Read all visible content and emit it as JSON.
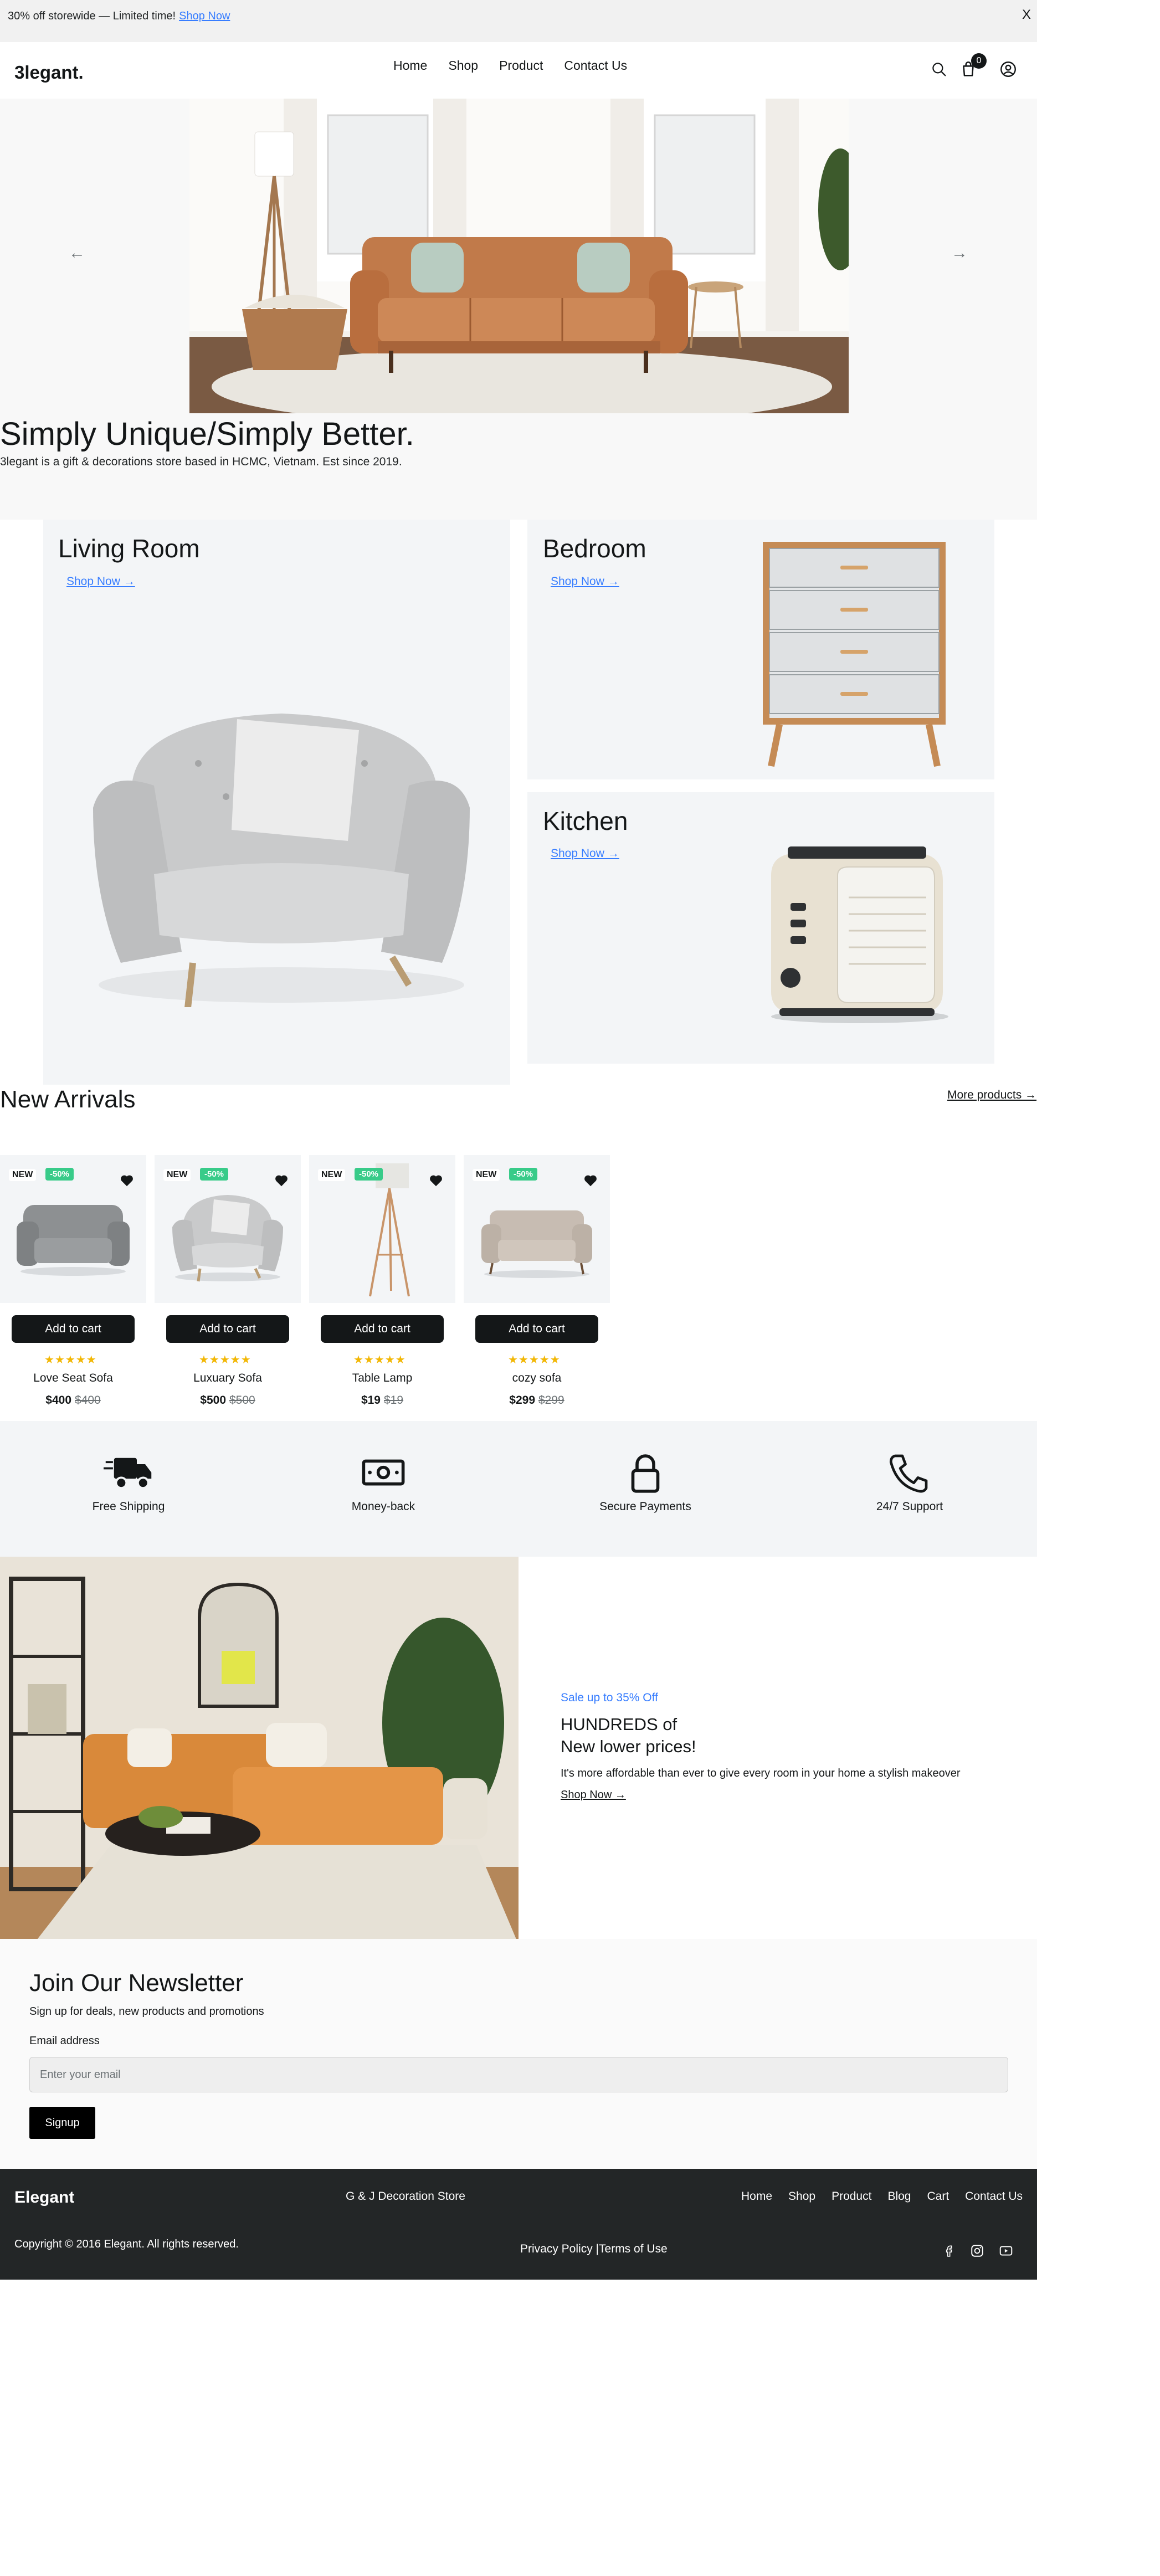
{
  "promo": {
    "text": "30% off storewide — Limited time!",
    "link": "Shop Now",
    "close": "X"
  },
  "header": {
    "logo": "3legant.",
    "nav": [
      "Home",
      "Shop",
      "Product",
      "Contact Us"
    ],
    "cart_count": "0",
    "icons": [
      "search-icon",
      "shopping-bag-icon",
      "user-account-icon"
    ]
  },
  "hero": {
    "prev_arrow": "←",
    "next_arrow": "→",
    "title": "Simply Unique/Simply Better.",
    "subtitle": "3legant is a gift & decorations store based in HCMC, Vietnam. Est since 2019."
  },
  "categories": [
    {
      "title": "Living Room",
      "link": "Shop Now →"
    },
    {
      "title": "Bedroom",
      "link": "Shop Now →"
    },
    {
      "title": "Kitchen",
      "link": "Shop Now →"
    }
  ],
  "new_arrivals": {
    "title": "New Arrivals",
    "more": "More products →",
    "products": [
      {
        "badge_new": "NEW",
        "badge_off": "-50%",
        "button": "Add to cart",
        "stars": "★★★★★",
        "name": "Love Seat Sofa",
        "price": "$400",
        "old_price": "$400"
      },
      {
        "badge_new": "NEW",
        "badge_off": "-50%",
        "button": "Add to cart",
        "stars": "★★★★★",
        "name": "Luxuary Sofa",
        "price": "$500",
        "old_price": "$500"
      },
      {
        "badge_new": "NEW",
        "badge_off": "-50%",
        "button": "Add to cart",
        "stars": "★★★★★",
        "name": "Table Lamp",
        "price": "$19",
        "old_price": "$19"
      },
      {
        "badge_new": "NEW",
        "badge_off": "-50%",
        "button": "Add to cart",
        "stars": "★★★★★",
        "name": "cozy sofa",
        "price": "$299",
        "old_price": "$299"
      }
    ]
  },
  "features": [
    {
      "label": "Free Shipping",
      "icon": "delivery-truck-icon"
    },
    {
      "label": "Money-back",
      "icon": "money-icon"
    },
    {
      "label": "Secure Payments",
      "icon": "lock-icon"
    },
    {
      "label": "24/7 Support",
      "icon": "phone-icon"
    }
  ],
  "banner": {
    "sale": "Sale up to 35% Off",
    "heading_line1": "HUNDREDS of",
    "heading_line2": "New lower prices!",
    "text": "It's more affordable than ever to give every room in your home a stylish makeover",
    "link": "Shop Now →"
  },
  "newsletter": {
    "title": "Join Our Newsletter",
    "subtitle": "Sign up for deals, new products and promotions",
    "label": "Email address",
    "placeholder": "Enter your email",
    "button": "Signup"
  },
  "footer": {
    "logo": "Elegant",
    "store": "G & J Decoration Store",
    "nav": [
      "Home",
      "Shop",
      "Product",
      "Blog",
      "Cart",
      "Contact Us"
    ],
    "copyright": "Copyright © 2016 Elegant. All rights reserved.",
    "privacy": "Privacy Policy",
    "separator": "|",
    "terms": "Terms of Use",
    "social": [
      "facebook-icon",
      "instagram-icon",
      "youtube-icon"
    ]
  },
  "colors": {
    "accent": "#377dff",
    "dark": "#141718",
    "sale_badge": "#38cb89",
    "star": "#f2b705",
    "footer_bg": "#232627"
  }
}
